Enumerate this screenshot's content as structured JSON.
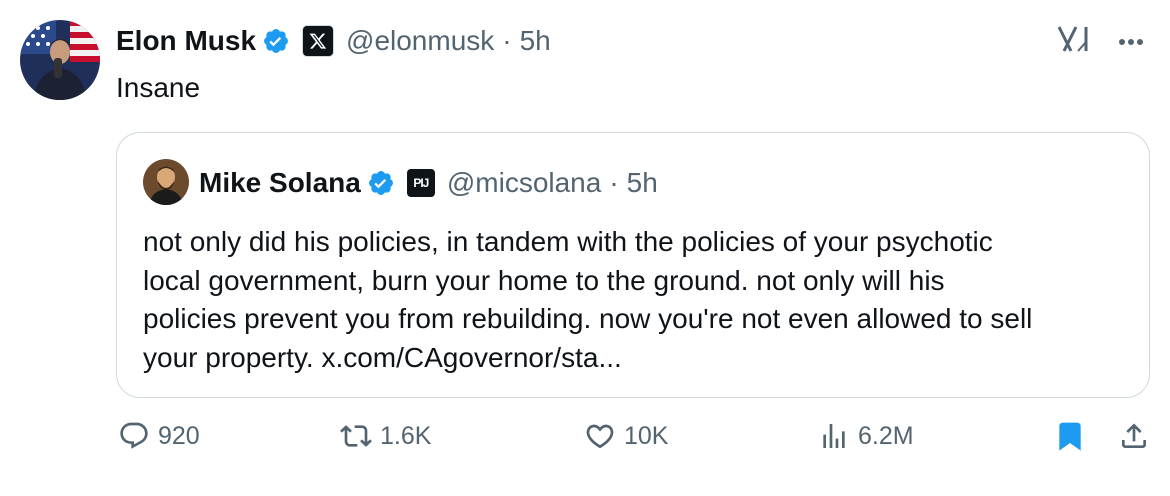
{
  "author": {
    "name": "Elon Musk",
    "handle": "@elonmusk",
    "time": "5h",
    "separator": "·"
  },
  "tweet": {
    "text": "Insane"
  },
  "quoted": {
    "name": "Mike Solana",
    "handle": "@micsolana",
    "time": "5h",
    "separator": "·",
    "affiliation_badge": "PIJ",
    "text_lines": [
      "not only did his policies, in tandem with the policies of your psychotic",
      "local government, burn your home to the ground. not only will his",
      "policies prevent you from rebuilding. now you're not even allowed to sell",
      "your property. x.com/CAgovernor/sta..."
    ]
  },
  "actions": {
    "replies": "920",
    "reposts": "1.6K",
    "likes": "10K",
    "views": "6.2M"
  },
  "icons": {
    "verified": "verified-badge-icon",
    "affiliation": "x-logo-icon",
    "grok": "grok-icon",
    "more": "more-icon",
    "reply": "reply-icon",
    "repost": "repost-icon",
    "like": "heart-icon",
    "views": "views-chart-icon",
    "bookmark": "bookmark-icon",
    "share": "share-icon"
  },
  "colors": {
    "verified": "#1d9bf0",
    "bookmark": "#1d9bf0",
    "muted": "#536471",
    "text": "#0f1419",
    "border": "#cfd9de"
  }
}
